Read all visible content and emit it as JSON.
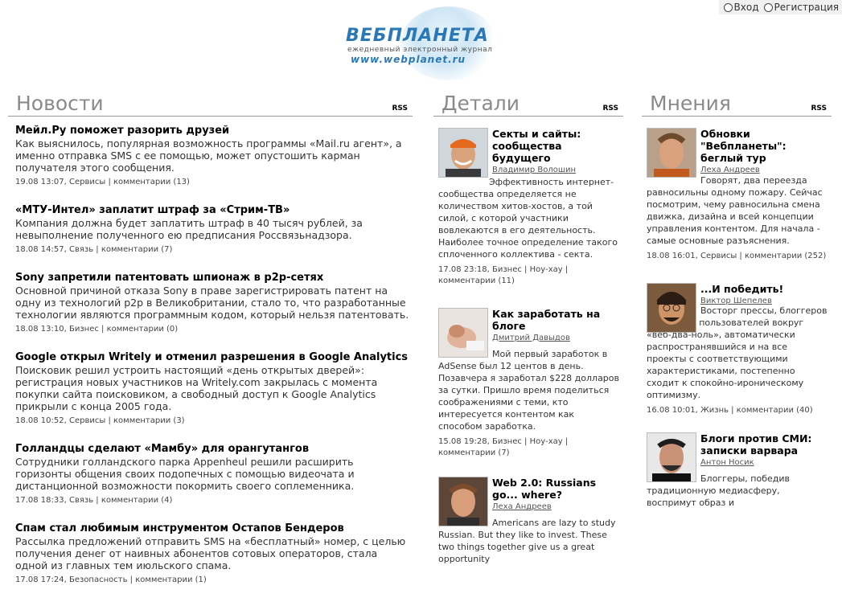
{
  "auth": {
    "login": "Вход",
    "register": "Регистрация"
  },
  "logo": {
    "brand": "ВЕБПЛАНЕТА",
    "tagline": "ежедневный электронный журнал",
    "url": "www.webplanet.ru"
  },
  "news": {
    "heading": "Новости",
    "rss": "RSS",
    "items": [
      {
        "title": "Мейл.Ру поможет разорить друзей",
        "lead": "Как выяснилось, популярная возможность программы «Mail.ru агент», а именно отправка SMS с ее помощью, может опустошить карман получателя этого сообщения.",
        "date": "19.08 13:07",
        "section": "Сервисы",
        "comments": "комментарии (13)"
      },
      {
        "title": "«МТУ-Интел» заплатит штраф за «Стрим-ТВ»",
        "lead": "Компания должна будет заплатить штраф в 40 тысяч рублей, за невыполнение полученного ею предписания Россвязьнадзора.",
        "date": "18.08 14:57",
        "section": "Связь",
        "comments": "комментарии (7)"
      },
      {
        "title": "Sony запретили патентовать шпионаж в p2p-сетях",
        "lead": "Основной причиной отказа Sony в праве зарегистрировать патент на одну из технологий p2p в Великобритании, стало то, что разработанные технологии являются программным кодом, который нельзя патентовать.",
        "date": "18.08 13:10",
        "section": "Бизнес",
        "comments": "комментарии (0)"
      },
      {
        "title": "Google открыл Writely и отменил разрешения в Google Analytics",
        "lead": "Поисковик решил устроить настоящий «день открытых дверей»: регистрация новых участников на Writely.com закрылась с момента покупки сайта поисковиком, а свободный доступ к Google Analytics прикрыли с конца 2005 года.",
        "date": "18.08 10:52",
        "section": "Сервисы",
        "comments": "комментарии (3)"
      },
      {
        "title": "Голландцы сделают «Мамбу» для орангутангов",
        "lead": "Сотрудники голландского парка Appenheul решили расширить горизонты общения своих подопечных с помощью видеочата и дистанционной возможности покормить своего соплеменника.",
        "date": "17.08 18:33",
        "section": "Связь",
        "comments": "комментарии (4)"
      },
      {
        "title": "Спам стал любимым инструментом Остапов Бендеров",
        "lead": "Рассылка предложений отправить SMS на «бесплатный» номер, с целью получения денег от наивных абонентов сотовых операторов, стала одной из главных тем июльского спама.",
        "date": "17.08 17:24",
        "section": "Безопасность",
        "comments": "комментарии (1)"
      }
    ]
  },
  "details": {
    "heading": "Детали",
    "rss": "RSS",
    "items": [
      {
        "title": "Секты и сайты: сообщества будущего",
        "author": "Владимир Волошин",
        "body": "Эффективность интернет-сообщества определяется не количеством хитов-хостов, а той силой, с которой участники вовлекаются в его деятельность. Наиболее точное определение такого сплоченного коллектива - секта.",
        "meta": "17.08 23:18, Бизнес | Ноу-хау | комментарии (11)"
      },
      {
        "title": "Как заработать на блоге",
        "author": "Дмитрий Давыдов",
        "body": "Мой первый заработок в AdSense был 12 центов в день. Позавчера я заработал $228 долларов за сутки. Пришло время поделиться соображениями с теми, кто интересуется контентом как способом заработка.",
        "meta": "15.08 19:28, Бизнес | Ноу-хау | комментарии (7)"
      },
      {
        "title": "Web 2.0: Russians go... where?",
        "author": "Леха Андреев",
        "body": "Americans are lazy to study Russian. But they like to invest. These two things together give us a great opportunity",
        "meta": ""
      }
    ]
  },
  "opinions": {
    "heading": "Мнения",
    "rss": "RSS",
    "items": [
      {
        "title": "Обновки \"Вебпланеты\": беглый тур",
        "author": "Леха Андреев",
        "body": "Говорят, два переезда равносильны одному пожару. Сейчас посмотрим, чему равносильна смена движка, дизайна и всей концепции управления контентом. Для начала - самые основные разъяснения.",
        "meta": "18.08 16:01, Сервисы | комментарии (252)"
      },
      {
        "title": "...И победить!",
        "author": "Виктор Шепелев",
        "body": "Восторг прессы, блоггеров и обычных пользователей вокруг «веб-два-ноль», автоматически распространявшийся и на все проекты с соответствующими характеристиками, постепенно сходит к спокойно-ироническому оптимизму.",
        "meta": "16.08 10:01, Жизнь | комментарии (40)"
      },
      {
        "title": "Блоги против СМИ: записки варвара",
        "author": "Антон Носик",
        "body": "Блоггеры, победив традиционную медиасферу, воспримут образ и",
        "meta": ""
      }
    ]
  }
}
